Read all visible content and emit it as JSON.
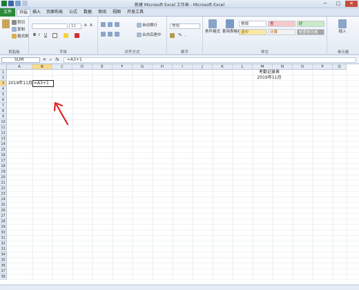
{
  "window": {
    "title": "新建 Microsoft Excel 工作表 - Microsoft Excel",
    "minimize": "─",
    "maximize": "□",
    "close": "✕"
  },
  "tabs": {
    "file": "文件",
    "items": [
      "开始",
      "插入",
      "页面布局",
      "公式",
      "数据",
      "审阅",
      "视图",
      "开发工具"
    ]
  },
  "ribbon": {
    "clipboard": {
      "label": "剪贴板",
      "cut": "剪切",
      "copy": "复制",
      "painter": "格式刷"
    },
    "font": {
      "label": "字体",
      "size": "11",
      "bold": "B",
      "italic": "I",
      "underline": "U"
    },
    "alignment": {
      "label": "对齐方式",
      "wrap": "自动换行",
      "merge": "合并后居中"
    },
    "number": {
      "label": "数字",
      "format": "常规",
      "percent": "%"
    },
    "styles": {
      "label": "样式",
      "conditional": "条件格式",
      "table": "套用表格格式",
      "cells": [
        "常规",
        "差",
        "好",
        "适中",
        "计算",
        "检查单元格"
      ]
    },
    "cells": {
      "label": "单元格",
      "insert": "插入"
    }
  },
  "formula_bar": {
    "name_box": "SUM",
    "cancel": "✕",
    "enter": "✓",
    "fx": "fx",
    "content": "=A3+1"
  },
  "sheet": {
    "columns": [
      "A",
      "B",
      "C",
      "D",
      "E",
      "F",
      "G",
      "H",
      "I",
      "J",
      "K",
      "L",
      "M",
      "N",
      "O",
      "P",
      "Q"
    ],
    "rows": [
      "1",
      "2",
      "3",
      "4",
      "5",
      "6",
      "7",
      "8",
      "9",
      "10",
      "11",
      "12",
      "13",
      "14",
      "15",
      "16",
      "17",
      "18",
      "19",
      "20",
      "21",
      "22",
      "23",
      "24",
      "25",
      "26",
      "27",
      "28",
      "29",
      "30",
      "31",
      "32",
      "33",
      "34",
      "35",
      "36",
      "37",
      "38"
    ],
    "selected_column": "B",
    "selected_row": "3",
    "cells": {
      "O1": "考勤记录表",
      "O2": "2019年11月",
      "A3": "2019年11月",
      "B3": "=A3+1"
    }
  },
  "colors": {
    "file_tab": "#2a8a3a",
    "header_bg": "#e4ebf4",
    "selected_header": "#f8dc8c",
    "arrow": "#e02020",
    "gridline": "#dde3ea"
  }
}
